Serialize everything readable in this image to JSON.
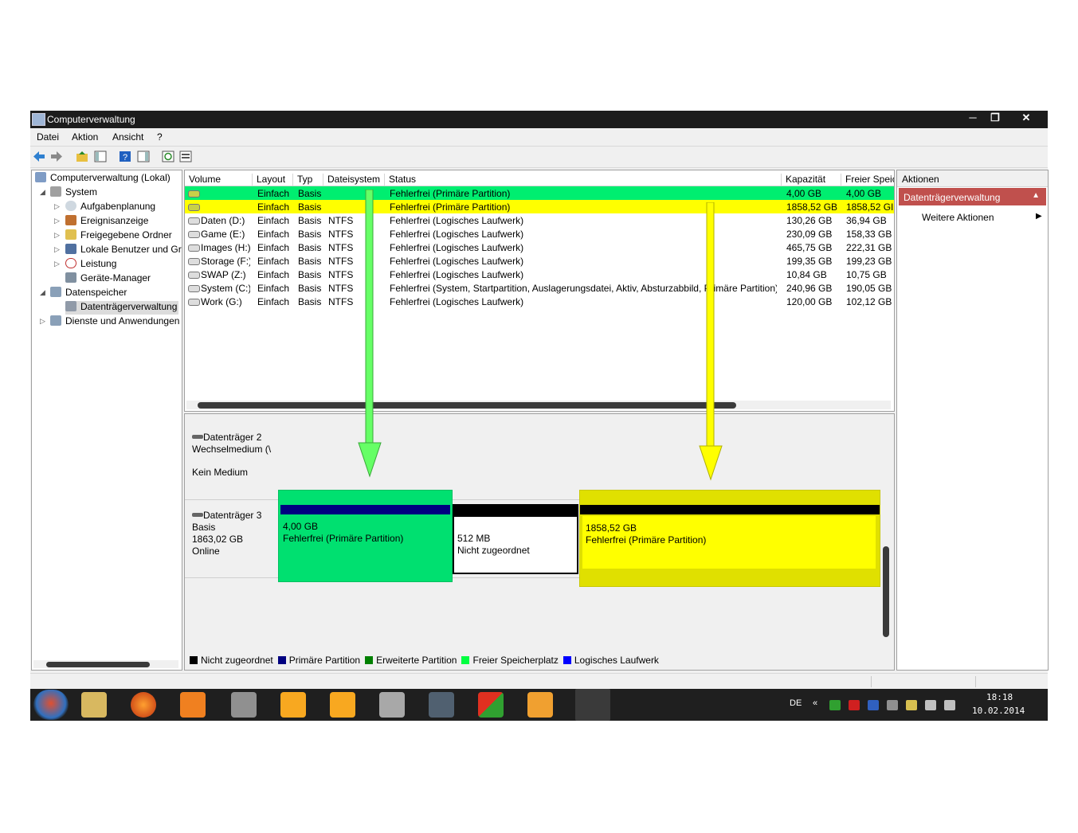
{
  "window": {
    "title": "Computerverwaltung"
  },
  "menu": [
    "Datei",
    "Aktion",
    "Ansicht",
    "?"
  ],
  "tree": {
    "root": "Computerverwaltung (Lokal)",
    "system": "System",
    "system_items": [
      "Aufgabenplanung",
      "Ereignisanzeige",
      "Freigegebene Ordner",
      "Lokale Benutzer und Gr",
      "Leistung",
      "Geräte-Manager"
    ],
    "storage": "Datenspeicher",
    "storage_items": [
      "Datenträgerverwaltung"
    ],
    "services": "Dienste und Anwendungen"
  },
  "volumes": {
    "columns": [
      "Volume",
      "Layout",
      "Typ",
      "Dateisystem",
      "Status",
      "Kapazität",
      "Freier Speic"
    ],
    "rows": [
      {
        "volume": "",
        "layout": "Einfach",
        "typ": "Basis",
        "fs": "",
        "status": "Fehlerfrei (Primäre Partition)",
        "cap": "4,00 GB",
        "free": "4,00 GB",
        "hl": "#00ee70"
      },
      {
        "volume": "",
        "layout": "Einfach",
        "typ": "Basis",
        "fs": "",
        "status": "Fehlerfrei (Primäre Partition)",
        "cap": "1858,52 GB",
        "free": "1858,52 GI",
        "hl": "#ffff00"
      },
      {
        "volume": "Daten (D:)",
        "layout": "Einfach",
        "typ": "Basis",
        "fs": "NTFS",
        "status": "Fehlerfrei (Logisches Laufwerk)",
        "cap": "130,26 GB",
        "free": "36,94 GB",
        "hl": ""
      },
      {
        "volume": "Game (E:)",
        "layout": "Einfach",
        "typ": "Basis",
        "fs": "NTFS",
        "status": "Fehlerfrei (Logisches Laufwerk)",
        "cap": "230,09 GB",
        "free": "158,33 GB",
        "hl": ""
      },
      {
        "volume": "Images (H:)",
        "layout": "Einfach",
        "typ": "Basis",
        "fs": "NTFS",
        "status": "Fehlerfrei (Logisches Laufwerk)",
        "cap": "465,75 GB",
        "free": "222,31 GB",
        "hl": ""
      },
      {
        "volume": "Storage (F:)",
        "layout": "Einfach",
        "typ": "Basis",
        "fs": "NTFS",
        "status": "Fehlerfrei (Logisches Laufwerk)",
        "cap": "199,35 GB",
        "free": "199,23 GB",
        "hl": ""
      },
      {
        "volume": "SWAP (Z:)",
        "layout": "Einfach",
        "typ": "Basis",
        "fs": "NTFS",
        "status": "Fehlerfrei (Logisches Laufwerk)",
        "cap": "10,84 GB",
        "free": "10,75 GB",
        "hl": ""
      },
      {
        "volume": "System (C:)",
        "layout": "Einfach",
        "typ": "Basis",
        "fs": "NTFS",
        "status": "Fehlerfrei (System, Startpartition, Auslagerungsdatei, Aktiv, Absturzabbild, Primäre Partition)",
        "cap": "240,96 GB",
        "free": "190,05 GB",
        "hl": ""
      },
      {
        "volume": "Work (G:)",
        "layout": "Einfach",
        "typ": "Basis",
        "fs": "NTFS",
        "status": "Fehlerfrei (Logisches Laufwerk)",
        "cap": "120,00 GB",
        "free": "102,12 GB",
        "hl": ""
      }
    ]
  },
  "disks": {
    "disk2": {
      "name": "Datenträger 2",
      "type": "Wechselmedium (\\",
      "state": "Kein Medium"
    },
    "disk3": {
      "name": "Datenträger 3",
      "type": "Basis",
      "size": "1863,02 GB",
      "state": "Online"
    },
    "partitions": [
      {
        "size": "4,00 GB",
        "status": "Fehlerfrei (Primäre Partition)"
      },
      {
        "size": "512 MB",
        "status": "Nicht zugeordnet"
      },
      {
        "size": "1858,52 GB",
        "status": "Fehlerfrei (Primäre Partition)"
      }
    ]
  },
  "legend": [
    {
      "label": "Nicht zugeordnet",
      "color": "#000000"
    },
    {
      "label": "Primäre Partition",
      "color": "#000080"
    },
    {
      "label": "Erweiterte Partition",
      "color": "#008000"
    },
    {
      "label": "Freier Speicherplatz",
      "color": "#00ff40"
    },
    {
      "label": "Logisches Laufwerk",
      "color": "#0000ff"
    }
  ],
  "actions": {
    "header": "Aktionen",
    "section": "Datenträgerverwaltung",
    "item": "Weitere Aktionen"
  },
  "taskbar": {
    "lang": "DE",
    "time": "18:18",
    "date": "10.02.2014"
  },
  "colors": {
    "green_highlight": "#00ee70",
    "yellow_highlight": "#ffff00",
    "arrow_green": "#66ff66",
    "arrow_yellow": "#ffff00"
  }
}
